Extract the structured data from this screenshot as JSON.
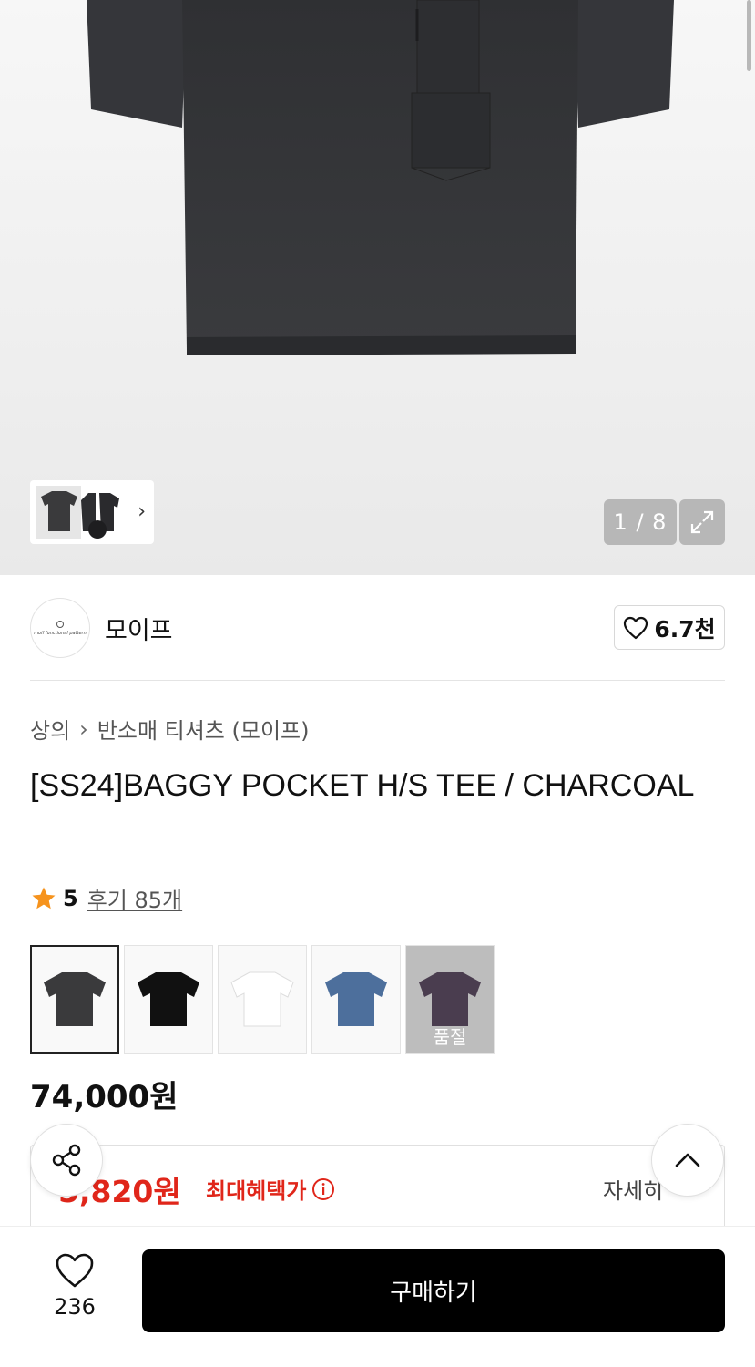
{
  "gallery": {
    "counter": "1 / 8"
  },
  "brand": {
    "name": "모이프",
    "logo_text": "moif functional pattern",
    "like_count": "6.7천"
  },
  "breadcrumb": {
    "category": "상의",
    "subcategory": "반소매 티셔츠 (모이프)"
  },
  "product": {
    "title": "[SS24]BAGGY POCKET H/S TEE / CHARCOAL",
    "rating": "5",
    "reviews": "후기 85개",
    "price": "74,000원"
  },
  "swatches": [
    {
      "color": "#3a3a3c",
      "selected": true
    },
    {
      "color": "#111111"
    },
    {
      "color": "#ffffff"
    },
    {
      "color": "#4d6f9c"
    },
    {
      "color": "#4a3d4f",
      "soldout_label": "품절"
    }
  ],
  "benefit": {
    "amount": "5,820원",
    "label": "최대혜택가",
    "detail": "자세히"
  },
  "bottom": {
    "wish_count": "236",
    "buy_label": "구매하기"
  },
  "colors": {
    "accent_red": "#e0261a",
    "star": "#f6931d"
  }
}
